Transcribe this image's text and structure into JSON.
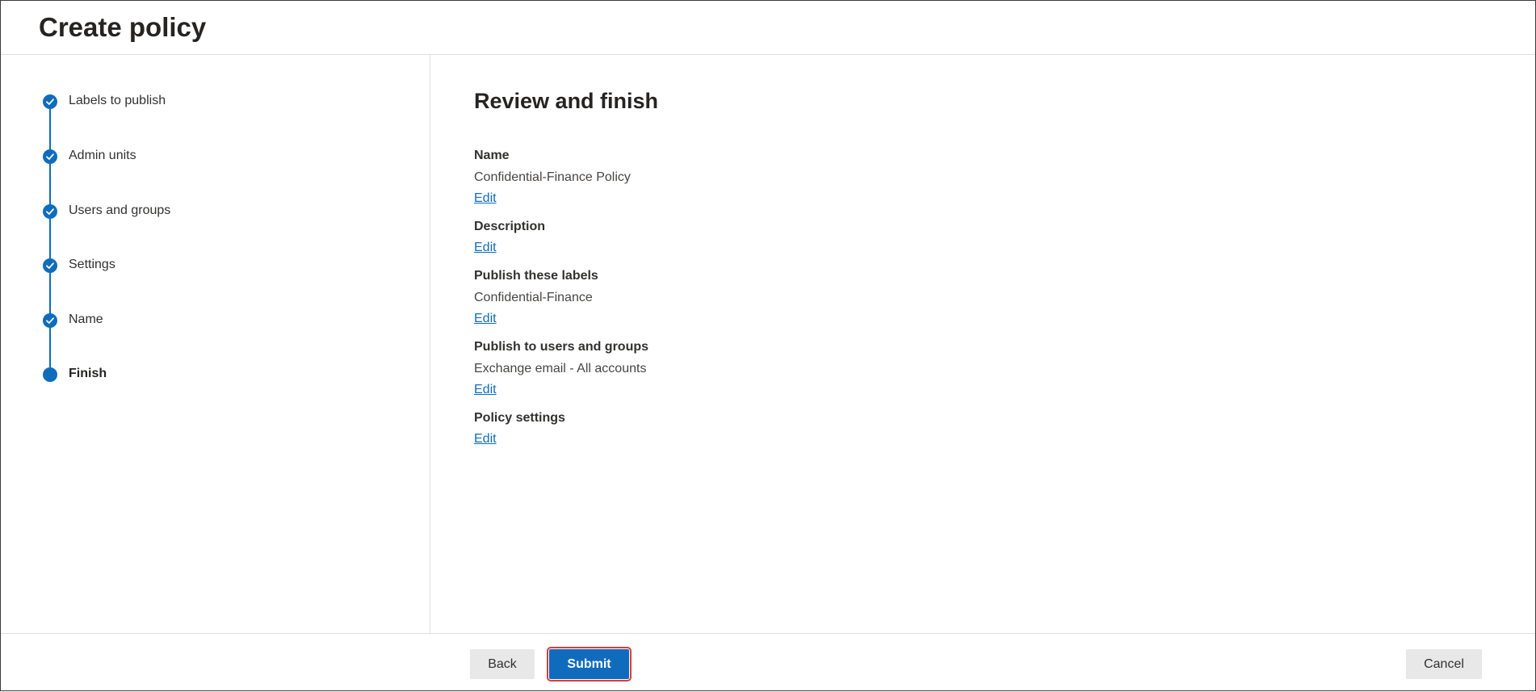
{
  "header": {
    "title": "Create policy"
  },
  "steps": [
    {
      "label": "Labels to publish",
      "state": "completed"
    },
    {
      "label": "Admin units",
      "state": "completed"
    },
    {
      "label": "Users and groups",
      "state": "completed"
    },
    {
      "label": "Settings",
      "state": "completed"
    },
    {
      "label": "Name",
      "state": "completed"
    },
    {
      "label": "Finish",
      "state": "current"
    }
  ],
  "main": {
    "title": "Review and finish",
    "fields": [
      {
        "title": "Name",
        "value": "Confidential-Finance Policy",
        "edit_label": "Edit"
      },
      {
        "title": "Description",
        "value": "",
        "edit_label": "Edit"
      },
      {
        "title": "Publish these labels",
        "value": "Confidential-Finance",
        "edit_label": "Edit"
      },
      {
        "title": "Publish to users and groups",
        "value": "Exchange email - All accounts",
        "edit_label": "Edit"
      },
      {
        "title": "Policy settings",
        "value": "",
        "edit_label": "Edit"
      }
    ]
  },
  "footer": {
    "back_label": "Back",
    "submit_label": "Submit",
    "cancel_label": "Cancel"
  },
  "colors": {
    "accent": "#0f6cbd",
    "highlight_outline": "#e03a3a"
  },
  "icons": {
    "completed_step": "checkmark-icon",
    "current_step": "current-step-dot-icon"
  }
}
